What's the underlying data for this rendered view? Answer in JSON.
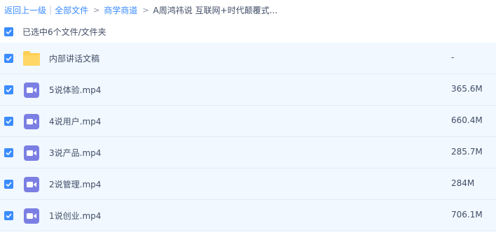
{
  "breadcrumb": {
    "back": "返回上一级",
    "all_files": "全部文件",
    "folder1": "商学商道",
    "current": "A周鸿祎说 互联网+时代颠覆式..."
  },
  "selection": {
    "label": "已选中6个文件/文件夹"
  },
  "files": [
    {
      "name": "内部讲话文稿",
      "size": "-",
      "type": "folder"
    },
    {
      "name": "5说体验.mp4",
      "size": "365.6M",
      "type": "video"
    },
    {
      "name": "4说用户.mp4",
      "size": "660.4M",
      "type": "video"
    },
    {
      "name": "3说产品.mp4",
      "size": "285.7M",
      "type": "video"
    },
    {
      "name": "2说管理.mp4",
      "size": "284M",
      "type": "video"
    },
    {
      "name": "1说创业.mp4",
      "size": "706.1M",
      "type": "video"
    }
  ],
  "colors": {
    "accent": "#3b8cff",
    "row_bg": "#f1f8ff",
    "video_icon": "#7b7fe3",
    "folder_icon": "#ffce54"
  },
  "icons": {
    "checkbox": "check-icon",
    "folder": "folder-icon",
    "video": "video-icon"
  }
}
